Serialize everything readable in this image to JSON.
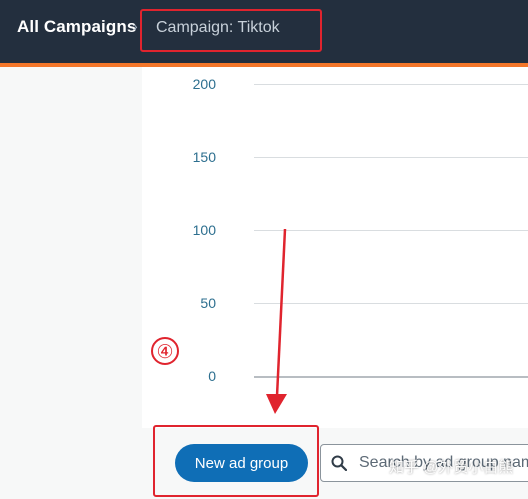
{
  "header": {
    "breadcrumb_root": "All Campaigns",
    "separator": "›",
    "breadcrumb_current": "Campaign: Tiktok"
  },
  "chart_data": {
    "type": "line",
    "yticks": [
      200,
      150,
      100,
      50,
      0
    ],
    "ylim": [
      0,
      200
    ],
    "grid": true,
    "series": []
  },
  "annotation": {
    "step_number": "④"
  },
  "toolbar": {
    "new_ad_group_label": "New ad group",
    "search_placeholder": "Search by ad group name"
  },
  "watermark": "知乎 @外贸小白熊",
  "colors": {
    "header_bg": "#232f3e",
    "accent_orange": "#f3762a",
    "primary_button": "#0f6eb6",
    "annotation_red": "#e0242e"
  }
}
